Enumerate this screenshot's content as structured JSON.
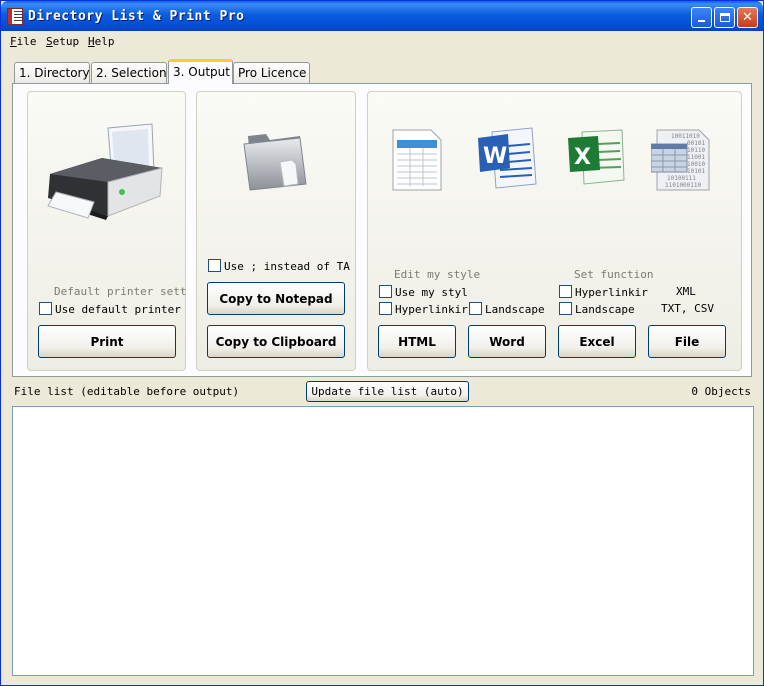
{
  "window": {
    "title": "Directory List & Print Pro"
  },
  "menu": [
    {
      "key": "F",
      "rest": "ile"
    },
    {
      "key": "S",
      "rest": "etup"
    },
    {
      "key": "H",
      "rest": "elp"
    }
  ],
  "tabs": [
    "1. Directory",
    "2. Selection",
    "3. Output",
    "Pro Licence"
  ],
  "print_group": {
    "caption": "Default printer sett",
    "checkbox_label": "Use default printer",
    "button": "Print"
  },
  "notepad_group": {
    "checkbox_label": "Use  ;  instead of TA",
    "notepad_button": "Copy to Notepad",
    "clipboard_button": "Copy to Clipboard"
  },
  "export_group": {
    "edit_style_caption": "Edit my style",
    "set_function_caption": "Set function",
    "use_my_style": "Use my styl",
    "hyperlink_html": "Hyperlinkir",
    "landscape_word": "Landscape",
    "hyperlink_excel": "Hyperlinkir",
    "landscape_excel": "Landscape",
    "xml_label": "XML",
    "txt_csv_label": "TXT, CSV",
    "html_button": "HTML",
    "word_button": "Word",
    "excel_button": "Excel",
    "file_button": "File",
    "file_icon_text": [
      "10011010",
      "00101",
      "10110",
      "11001",
      "10010",
      "10101",
      "10100111",
      "1101000110"
    ]
  },
  "file_list": {
    "label": "File list (editable before output)",
    "update_button": "Update file list (auto)",
    "count": "0 Objects"
  },
  "colors": {
    "titlebar": "#0a5fe6",
    "window_bg": "#ece9d8",
    "active_tab_accent": "#ffc83c",
    "excel_green": "#1e7b34",
    "word_blue": "#2a5fb6"
  }
}
